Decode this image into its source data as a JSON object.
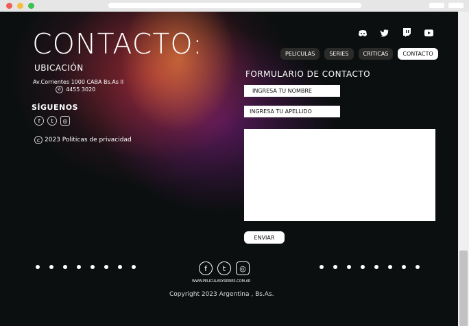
{
  "header": {
    "title": "CONTACTO:"
  },
  "nav": {
    "items": [
      "PELICULAS",
      "SERIES",
      "CRITICAS",
      "CONTACTO"
    ],
    "active": "CONTACTO"
  },
  "location": {
    "heading": "UBICACIÓN",
    "address": "Av.Corrientes 1000 CABA Bs.As II",
    "phone": "4455 3020"
  },
  "follow": {
    "heading": "SÍGUENOS"
  },
  "policy": {
    "text": "2023 Politicas de privacidad"
  },
  "form": {
    "heading": "FORMULARIO DE CONTACTO",
    "first_name_placeholder": "INGRESA TU NOMBRE",
    "last_name_placeholder": "INGRESA TU APELLIDO",
    "send_label": "ENVIAR"
  },
  "footer": {
    "site": "WWW.PELICULASYSERIES.COM.AR",
    "copyright": "Copyright 2023 Argentina , Bs.As."
  },
  "icons": {
    "top": [
      "discord-icon",
      "twitter-icon",
      "twitch-icon",
      "youtube-icon"
    ],
    "social": [
      "facebook-icon",
      "twitter-icon",
      "instagram-icon"
    ]
  }
}
